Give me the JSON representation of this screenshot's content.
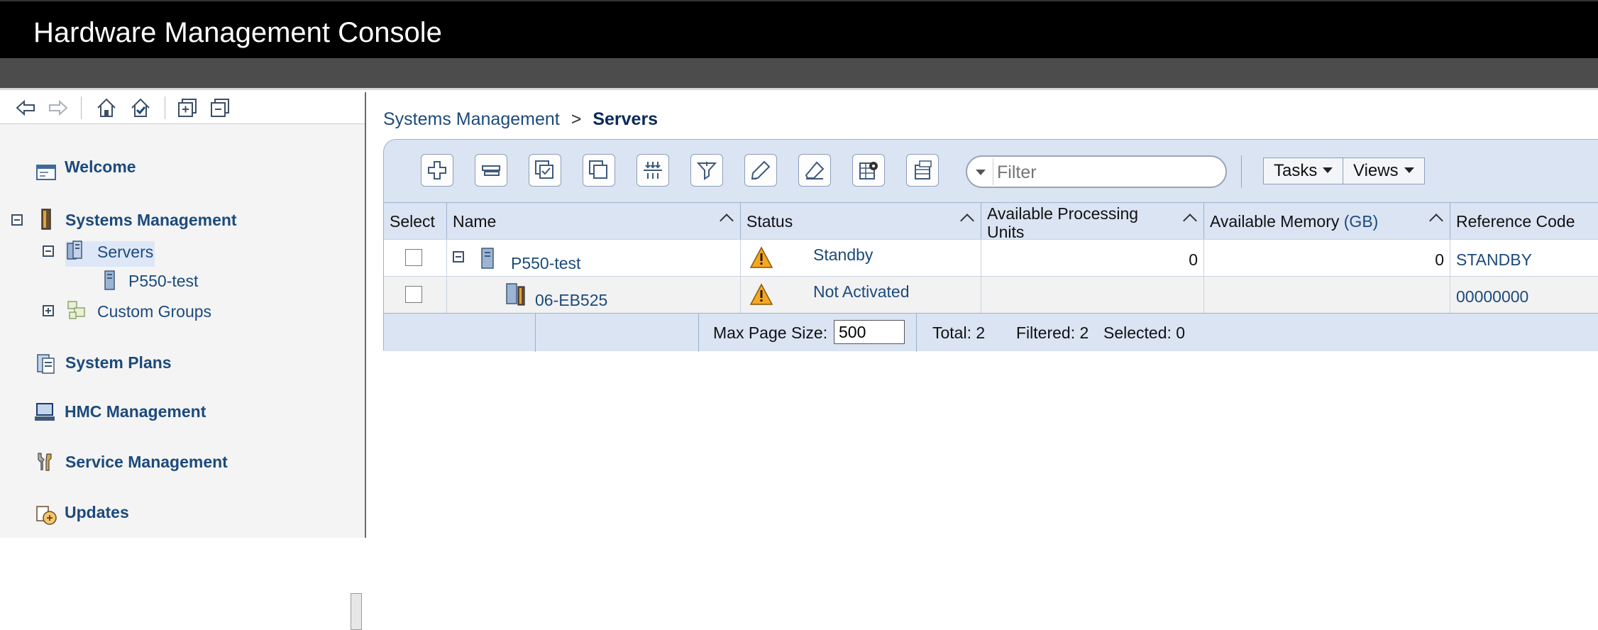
{
  "app": {
    "title": "Hardware Management Console"
  },
  "nav": {
    "items": [
      {
        "label": "Welcome"
      },
      {
        "label": "Systems Management"
      },
      {
        "label": "Servers"
      },
      {
        "label": "P550-test"
      },
      {
        "label": "Custom Groups"
      },
      {
        "label": "System Plans"
      },
      {
        "label": "HMC Management"
      },
      {
        "label": "Service Management"
      },
      {
        "label": "Updates"
      }
    ]
  },
  "breadcrumb": {
    "parent": "Systems Management",
    "separator": ">",
    "current": "Servers"
  },
  "toolbar": {
    "filter_placeholder": "Filter",
    "tasks_label": "Tasks",
    "views_label": "Views"
  },
  "table": {
    "columns": [
      {
        "label": "Select"
      },
      {
        "label": "Name"
      },
      {
        "label": "Status"
      },
      {
        "label": "Available Processing Units"
      },
      {
        "label": "Available Memory",
        "unit": "(GB)"
      },
      {
        "label": "Reference Code"
      }
    ],
    "rows": [
      {
        "name": "P550-test",
        "status": "Standby",
        "proc_units": "0",
        "memory": "0",
        "ref_code": "STANDBY"
      },
      {
        "name": "06-EB525",
        "status": "Not Activated",
        "proc_units": "",
        "memory": "",
        "ref_code": "00000000"
      }
    ],
    "footer": {
      "max_page_label": "Max Page Size:",
      "max_page_value": "500",
      "total": "Total: 2",
      "filtered": "Filtered: 2",
      "selected": "Selected: 0"
    }
  },
  "colors": {
    "link": "#1c4a7c",
    "header_bg": "#dbe4f3",
    "title_bg": "#000000",
    "warning": "#f5a623"
  }
}
